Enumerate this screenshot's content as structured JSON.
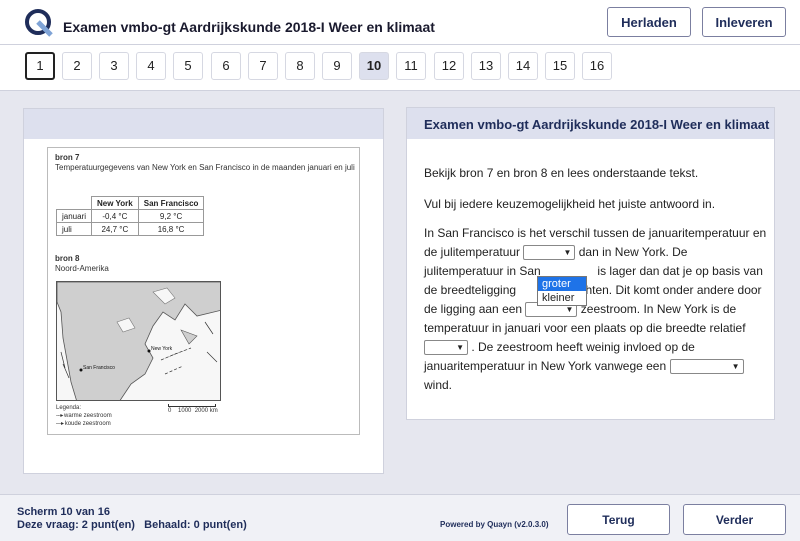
{
  "header": {
    "logo_icon": "quayn-logo-icon",
    "title": "Examen vmbo-gt Aardrijkskunde 2018-I Weer en klimaat",
    "reload_label": "Herladen",
    "submit_label": "Inleveren"
  },
  "question_nav": {
    "items": [
      "1",
      "2",
      "3",
      "4",
      "5",
      "6",
      "7",
      "8",
      "9",
      "10",
      "11",
      "12",
      "13",
      "14",
      "15",
      "16"
    ],
    "active": "10"
  },
  "source": {
    "bron7_title": "bron 7",
    "bron7_desc": "Temperatuurgegevens van New York en San Francisco in de maanden januari en juli",
    "table": {
      "headers": [
        "",
        "New York",
        "San Francisco"
      ],
      "rows": [
        [
          "januari",
          "-0,4 °C",
          "9,2 °C"
        ],
        [
          "juli",
          "24,7 °C",
          "16,8 °C"
        ]
      ]
    },
    "bron8_title": "bron 8",
    "bron8_desc": "Noord-Amerika",
    "map_labels": {
      "new_york": "New York",
      "san_francisco": "San Francisco"
    },
    "legend_title": "Legenda:",
    "legend_warm": "warme zeestroom",
    "legend_cold": "koude zeestroom",
    "scale_labels": [
      "0",
      "1000",
      "2000 km"
    ]
  },
  "question": {
    "title": "Examen vmbo-gt Aardrijkskunde 2018-I Weer en klimaat",
    "instruction1": "Bekijk bron 7 en bron 8 en lees onderstaande tekst.",
    "instruction2": "Vul bij iedere keuzemogelijkheid het juiste antwoord in.",
    "p1": "In San Francisco is het verschil tussen de januaritemperatuur en de julitemperatuur",
    "p2": "dan in New York. De julitemperatuur in San",
    "p3": "is lager dan dat je op basis van de breedteligging",
    "p4": "achten. Dit komt onder andere door de ligging aan een",
    "p5": "zeestroom. In New York is de temperatuur in januari voor een plaats op die breedte relatief",
    "p6": ". De zeestroom heeft weinig invloed op de januaritemperatuur in New York vanwege een",
    "p7": "wind.",
    "dropdown_options": [
      "groter",
      "kleiner"
    ],
    "dropdown_highlighted": "groter"
  },
  "footer": {
    "screen": "Scherm 10 van 16",
    "points": "Deze vraag: 2 punt(en)   Behaald: 0 punt(en)",
    "powered": "Powered by Quayn (v2.0.3.0)",
    "back_label": "Terug",
    "next_label": "Verder"
  }
}
